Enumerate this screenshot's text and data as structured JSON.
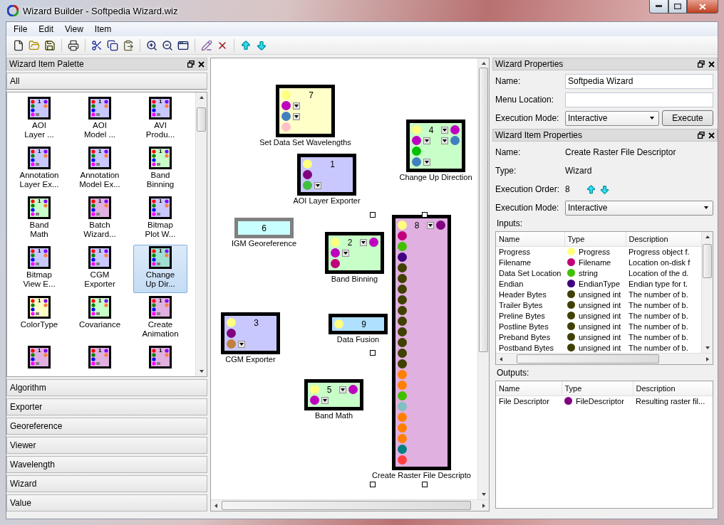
{
  "window": {
    "title": "Wizard Builder - Softpedia Wizard.wiz"
  },
  "menu": [
    "File",
    "Edit",
    "View",
    "Item"
  ],
  "toolbar": [
    {
      "kind": "new"
    },
    {
      "kind": "open"
    },
    {
      "kind": "save"
    },
    {
      "kind": "separator"
    },
    {
      "kind": "print"
    },
    {
      "kind": "separator"
    },
    {
      "kind": "cut"
    },
    {
      "kind": "copy"
    },
    {
      "kind": "paste"
    },
    {
      "kind": "separator"
    },
    {
      "kind": "zoom_in"
    },
    {
      "kind": "zoom_out"
    },
    {
      "kind": "zoom_fit"
    },
    {
      "kind": "separator"
    },
    {
      "kind": "edit"
    },
    {
      "kind": "delete"
    },
    {
      "kind": "separator"
    },
    {
      "kind": "move_up"
    },
    {
      "kind": "move_down"
    }
  ],
  "palette": {
    "title": "Wizard Item Palette",
    "categories": [
      {
        "label": "All",
        "expanded": true,
        "items": [
          {
            "label": "AOI\nLayer ...",
            "number": "1",
            "color": "#c8c8ff",
            "selected": false
          },
          {
            "label": "AOI\nModel ...",
            "number": "1",
            "color": "#c8c8ff",
            "selected": false
          },
          {
            "label": "AVI\nProdu...",
            "number": "1",
            "color": "#c8c8ff",
            "selected": false
          },
          {
            "label": "Annotation\nLayer Ex...",
            "number": "1",
            "color": "#c8c8ff",
            "selected": false
          },
          {
            "label": "Annotation\nModel Ex...",
            "number": "1",
            "color": "#c8c8ff",
            "selected": false
          },
          {
            "label": "Band\nBinning",
            "number": "1",
            "color": "#c8ffc8",
            "selected": false
          },
          {
            "label": "Band\nMath",
            "number": "1",
            "color": "#c8ffc8",
            "selected": false
          },
          {
            "label": "Batch\nWizard...",
            "number": "1",
            "color": "#e0b0e0",
            "selected": false
          },
          {
            "label": "Bitmap\nPlot W...",
            "number": "1",
            "color": "#c8c8ff",
            "selected": false
          },
          {
            "label": "Bitmap\nView E...",
            "number": "1",
            "color": "#c8c8ff",
            "selected": false
          },
          {
            "label": "CGM\nExporter",
            "number": "1",
            "color": "#c8c8ff",
            "selected": false
          },
          {
            "label": "Change\nUp Dir...",
            "number": "1",
            "color": "#a0e0d4",
            "selected": true
          },
          {
            "label": "ColorType",
            "number": "1",
            "color": "#ffffc8",
            "selected": false
          },
          {
            "label": "Covariance",
            "number": "1",
            "color": "#c8ffc8",
            "selected": false
          },
          {
            "label": "Create\nAnimation",
            "number": "1",
            "color": "#e0b0e0",
            "selected": false
          },
          {
            "number": "1",
            "color": "#e0b0e0",
            "selected": false
          },
          {
            "number": "1",
            "color": "#e0b0e0",
            "selected": false
          },
          {
            "number": "1",
            "color": "#e0b0e0",
            "selected": false
          }
        ]
      },
      {
        "label": "Algorithm",
        "expanded": false
      },
      {
        "label": "Exporter",
        "expanded": false
      },
      {
        "label": "Georeference",
        "expanded": false
      },
      {
        "label": "Viewer",
        "expanded": false
      },
      {
        "label": "Wavelength",
        "expanded": false
      },
      {
        "label": "Wizard",
        "expanded": false
      },
      {
        "label": "Value",
        "expanded": false
      }
    ]
  },
  "canvas": {
    "nodes": [
      {
        "number": "7",
        "label": "Set Data Set Wavelengths",
        "kind": "standard",
        "color": "#ffffc8",
        "selected": false,
        "rows": [
          {
            "input": {
              "color": "#ffff80",
              "dropdown": false
            }
          },
          {
            "input": {
              "color": "#c000c0",
              "dropdown": true
            }
          },
          {
            "input": {
              "color": "#4080c0",
              "dropdown": true
            }
          },
          {
            "input": {
              "color": "#ffc0c8",
              "dropdown": false
            }
          }
        ]
      },
      {
        "number": "4",
        "label": "Change Up Direction",
        "kind": "standard",
        "color": "#c8ffc8",
        "selected": false,
        "rows": [
          {
            "input": {
              "color": "#ffff80",
              "dropdown": false
            },
            "output": {
              "color": "#c000c0",
              "dropdown": true
            }
          },
          {
            "input": {
              "color": "#c000c0",
              "dropdown": true
            },
            "output": {
              "color": "#4080c0",
              "dropdown": true
            }
          },
          {
            "input": {
              "color": "#00c000",
              "dropdown": false
            }
          },
          {
            "input": {
              "color": "#4080c0",
              "dropdown": true
            }
          }
        ]
      },
      {
        "number": "1",
        "label": "AOI Layer Exporter",
        "kind": "standard",
        "color": "#c8c8ff",
        "selected": false,
        "rows": [
          {
            "input": {
              "color": "#ffff80",
              "dropdown": false
            }
          },
          {
            "input": {
              "color": "#800080",
              "dropdown": false
            }
          },
          {
            "input": {
              "color": "#40c040",
              "dropdown": true
            }
          }
        ]
      },
      {
        "number": "6",
        "label": "IGM Georeference",
        "kind": "value",
        "color": "#c8ffff",
        "selected": false
      },
      {
        "number": "2",
        "label": "Band Binning",
        "kind": "standard",
        "color": "#c8ffc8",
        "selected": false,
        "rows": [
          {
            "input": {
              "color": "#ffff80",
              "dropdown": false
            },
            "output": {
              "color": "#c000c0",
              "dropdown": true
            }
          },
          {
            "input": {
              "color": "#c000c0",
              "dropdown": true
            }
          },
          {
            "input": {
              "color": "#c0007a",
              "dropdown": false
            }
          }
        ]
      },
      {
        "number": "8",
        "label": "Create Raster File Descripto",
        "kind": "standard",
        "color": "#e0b0e0",
        "selected": true,
        "rows": [
          {
            "input": {
              "color": "#ffff80",
              "dropdown": false
            },
            "output": {
              "color": "#800080",
              "dropdown": true
            }
          },
          {
            "input": {
              "color": "#c0007a",
              "dropdown": false
            }
          },
          {
            "input": {
              "color": "#40c000",
              "dropdown": false
            }
          },
          {
            "input": {
              "color": "#400080",
              "dropdown": false
            }
          },
          {
            "input": {
              "color": "#404000",
              "dropdown": false
            }
          },
          {
            "input": {
              "color": "#404000",
              "dropdown": false
            }
          },
          {
            "input": {
              "color": "#404000",
              "dropdown": false
            }
          },
          {
            "input": {
              "color": "#404000",
              "dropdown": false
            }
          },
          {
            "input": {
              "color": "#404000",
              "dropdown": false
            }
          },
          {
            "input": {
              "color": "#404000",
              "dropdown": false
            }
          },
          {
            "input": {
              "color": "#404000",
              "dropdown": false
            }
          },
          {
            "input": {
              "color": "#404000",
              "dropdown": false
            }
          },
          {
            "input": {
              "color": "#404000",
              "dropdown": false
            }
          },
          {
            "input": {
              "color": "#404000",
              "dropdown": false
            }
          },
          {
            "input": {
              "color": "#ff8000",
              "dropdown": false
            }
          },
          {
            "input": {
              "color": "#ff8000",
              "dropdown": false
            }
          },
          {
            "input": {
              "color": "#40c000",
              "dropdown": false
            }
          },
          {
            "input": {
              "color": "#80c0c0",
              "dropdown": false
            }
          },
          {
            "input": {
              "color": "#ff8000",
              "dropdown": false
            }
          },
          {
            "input": {
              "color": "#ff8000",
              "dropdown": false
            }
          },
          {
            "input": {
              "color": "#ff8000",
              "dropdown": false
            }
          },
          {
            "input": {
              "color": "#008080",
              "dropdown": false
            }
          },
          {
            "input": {
              "color": "#ff4040",
              "dropdown": false
            }
          }
        ]
      },
      {
        "number": "3",
        "label": "CGM Exporter",
        "kind": "standard",
        "color": "#c8c8ff",
        "selected": false,
        "rows": [
          {
            "input": {
              "color": "#ffff80",
              "dropdown": false
            }
          },
          {
            "input": {
              "color": "#800080",
              "dropdown": false
            }
          },
          {
            "input": {
              "color": "#c08040",
              "dropdown": true
            }
          }
        ]
      },
      {
        "number": "9",
        "label": "Data Fusion",
        "kind": "standard",
        "color": "#b0e0ff",
        "selected": false,
        "rows": [
          {
            "input": {
              "color": "#ffff80",
              "dropdown": false
            }
          }
        ]
      },
      {
        "number": "5",
        "label": "Band Math",
        "kind": "standard",
        "color": "#c8ffc8",
        "selected": false,
        "rows": [
          {
            "input": {
              "color": "#ffff80",
              "dropdown": false
            },
            "output": {
              "color": "#c000c0",
              "dropdown": true
            }
          },
          {
            "input": {
              "color": "#c000c0",
              "dropdown": true
            }
          }
        ]
      }
    ]
  },
  "wizard_properties": {
    "title": "Wizard Properties",
    "name_label": "Name:",
    "name_value": "Softpedia Wizard",
    "menu_location_label": "Menu Location:",
    "mode_label": "Execution Mode:",
    "mode_value": "Interactive",
    "execute_button": "Execute"
  },
  "item_properties": {
    "title": "Wizard Item Properties",
    "name_label": "Name:",
    "name_value": "Create Raster File Descriptor",
    "type_label": "Type:",
    "type_value": "Wizard",
    "order_label": "Execution Order:",
    "order_value": "8",
    "mode_label": "Execution Mode:",
    "mode_value": "Interactive",
    "inputs_label": "Inputs:",
    "inputs": {
      "columns": [
        "Name",
        "Type",
        "Description"
      ],
      "rows": [
        {
          "name": "Progress",
          "type": "Progress",
          "color": "#ffff80",
          "description": "Progress object f."
        },
        {
          "name": "Filename",
          "type": "Filename",
          "color": "#c0007a",
          "description": "Location on-disk f"
        },
        {
          "name": "Data Set Location",
          "type": "string",
          "color": "#40c000",
          "description": "Location of the d."
        },
        {
          "name": "Endian",
          "type": "EndianType",
          "color": "#400080",
          "description": "Endian type for t."
        },
        {
          "name": "Header Bytes",
          "type": "unsigned int",
          "color": "#404000",
          "description": "The number of b."
        },
        {
          "name": "Trailer Bytes",
          "type": "unsigned int",
          "color": "#404000",
          "description": "The number of b."
        },
        {
          "name": "Preline Bytes",
          "type": "unsigned int",
          "color": "#404000",
          "description": "The number of b."
        },
        {
          "name": "Postline Bytes",
          "type": "unsigned int",
          "color": "#404000",
          "description": "The number of b."
        },
        {
          "name": "Preband Bytes",
          "type": "unsigned int",
          "color": "#404000",
          "description": "The number of b."
        },
        {
          "name": "Postband Bytes",
          "type": "unsigned int",
          "color": "#404000",
          "description": "The number of b."
        }
      ]
    },
    "outputs_label": "Outputs:",
    "outputs": {
      "columns": [
        "Name",
        "Type",
        "Description"
      ],
      "rows": [
        {
          "name": "File Descriptor",
          "type": "FileDescriptor",
          "color": "#800080",
          "description": "Resulting raster fil..."
        }
      ]
    }
  }
}
